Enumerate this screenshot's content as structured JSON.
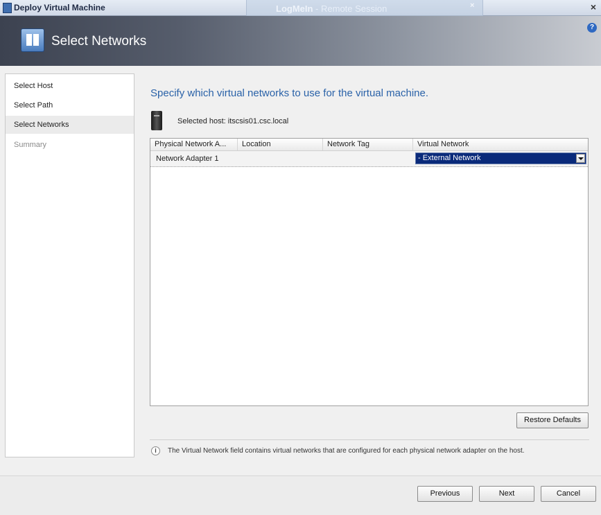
{
  "window": {
    "title": "Deploy Virtual Machine",
    "close_glyph": "×"
  },
  "remote_session": {
    "title": "LogMeIn",
    "subtitle": " - Remote Session",
    "close_glyph": "×"
  },
  "header": {
    "title": "Select Networks",
    "icon": "select-networks-icon",
    "help_glyph": "?"
  },
  "sidebar": {
    "items": [
      {
        "label": "Select Host",
        "state": "normal"
      },
      {
        "label": "Select Path",
        "state": "normal"
      },
      {
        "label": "Select Networks",
        "state": "selected"
      },
      {
        "label": "Summary",
        "state": "disabled"
      }
    ]
  },
  "main": {
    "heading": "Specify which virtual networks to use for the virtual machine.",
    "selected_host": "Selected host: itscsis01.csc.local"
  },
  "grid": {
    "columns": [
      "Physical Network A...",
      "Location",
      "Network Tag",
      "Virtual Network"
    ],
    "rows": [
      {
        "adapter": "Network Adapter 1",
        "location": "",
        "network_tag": "",
        "virtual_network": "- External Network"
      }
    ]
  },
  "buttons": {
    "restore_defaults": "Restore Defaults",
    "previous": "Previous",
    "next": "Next",
    "cancel": "Cancel"
  },
  "info": {
    "glyph": "i",
    "text": "The Virtual Network field contains virtual networks that are configured for each physical network adapter on the host."
  }
}
